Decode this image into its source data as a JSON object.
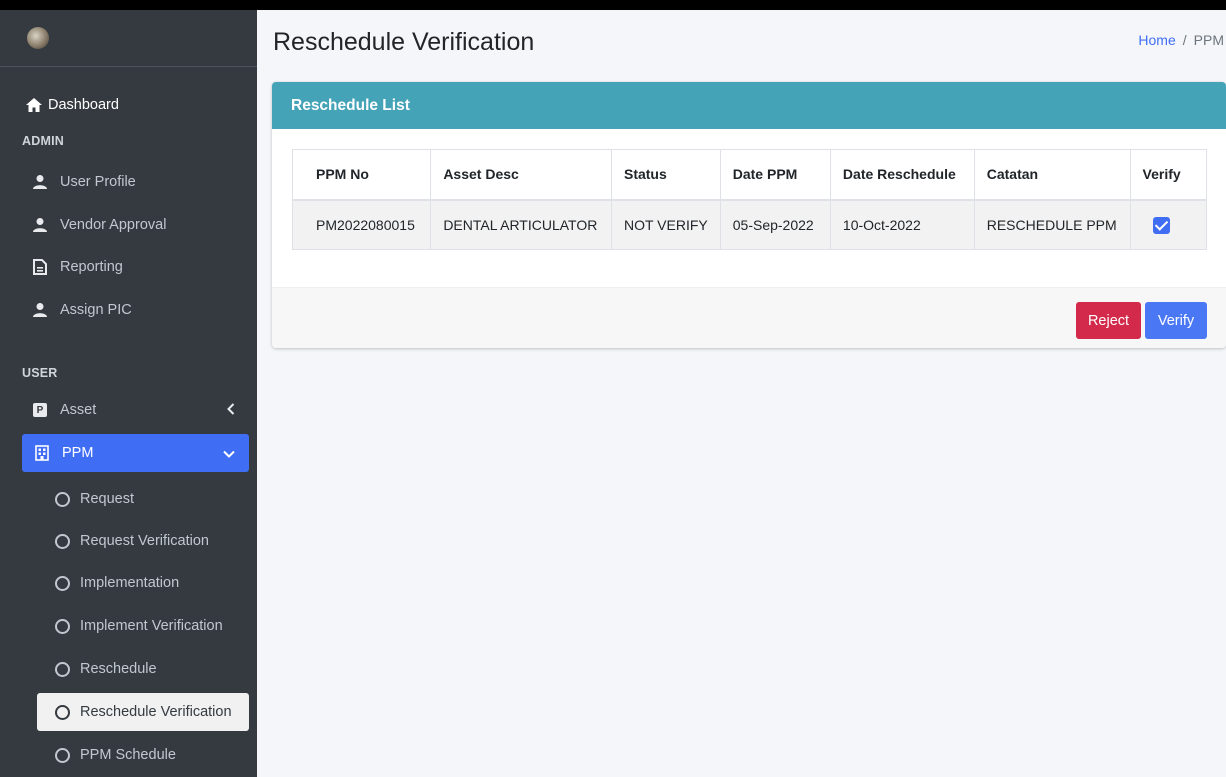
{
  "sidebar": {
    "dashboard": "Dashboard",
    "admin_header": "ADMIN",
    "admin_items": [
      {
        "label": "User Profile"
      },
      {
        "label": "Vendor Approval"
      },
      {
        "label": "Reporting"
      },
      {
        "label": "Assign PIC"
      }
    ],
    "user_header": "USER",
    "asset_label": "Asset",
    "ppm_label": "PPM",
    "ppm_sub": [
      {
        "label": "Request"
      },
      {
        "label": "Request Verification"
      },
      {
        "label": "Implementation"
      },
      {
        "label": "Implement Verification"
      },
      {
        "label": "Reschedule"
      },
      {
        "label": "Reschedule Verification"
      },
      {
        "label": "PPM Schedule"
      }
    ]
  },
  "header": {
    "title": "Reschedule Verification",
    "breadcrumb_home": "Home",
    "breadcrumb_sep": "/",
    "breadcrumb_current": "PPM"
  },
  "card": {
    "title": "Reschedule List",
    "columns": [
      "PPM No",
      "Asset Desc",
      "Status",
      "Date PPM",
      "Date Reschedule",
      "Catatan",
      "Verify"
    ],
    "rows": [
      {
        "ppm_no": "PM2022080015",
        "asset_desc": "DENTAL ARTICULATOR",
        "status": "NOT VERIFY",
        "date_ppm": "05-Sep-2022",
        "date_reschedule": "10-Oct-2022",
        "catatan": "RESCHEDULE PPM",
        "verify_checked": true
      }
    ],
    "reject_label": "Reject",
    "verify_label": "Verify"
  },
  "colors": {
    "sidebar_bg": "#343a40",
    "accent": "#3f6ef5",
    "card_header": "#45a3b8",
    "reject": "#d32a4b"
  }
}
